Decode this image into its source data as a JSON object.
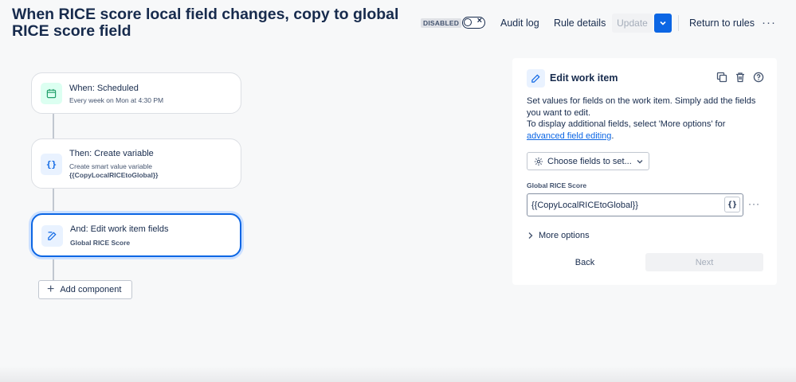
{
  "header": {
    "title": "When RICE score local field changes, copy to global RICE score field",
    "status_badge": "DISABLED",
    "toggle_icon": "close-icon",
    "audit_log": "Audit log",
    "rule_details": "Rule details",
    "update": "Update",
    "return": "Return to rules",
    "more": "···"
  },
  "flow": {
    "trigger": {
      "title": "When: Scheduled",
      "subtitle": "Every week on Mon at 4:30 PM",
      "icon": "calendar-icon"
    },
    "action1": {
      "title": "Then: Create variable",
      "subtitle": "Create smart value variable",
      "subtitle2": "{{CopyLocalRICEtoGlobal}}",
      "icon": "braces-icon"
    },
    "action2": {
      "title": "And: Edit work item fields",
      "subtitle": "Global RICE Score",
      "icon": "edit-icon"
    },
    "add_component": "Add component"
  },
  "panel": {
    "title": "Edit work item",
    "desc_line1": "Set values for fields on the work item. Simply add the fields you want to edit.",
    "desc_line2": "To display additional fields, select 'More options' for ",
    "desc_link": "advanced field editing",
    "desc_end": ".",
    "choose_fields": "Choose fields to set...",
    "field_label": "Global RICE Score",
    "field_value": "{{CopyLocalRICEtoGlobal}}",
    "braces": "{}",
    "field_more": "···",
    "more_options": "More options",
    "back": "Back",
    "next": "Next"
  },
  "colors": {
    "accent": "#0c66e4",
    "selected_glow": "#cce0ff",
    "trigger_icon_bg": "#dcfff1",
    "action_icon_bg": "#e9f2ff"
  }
}
